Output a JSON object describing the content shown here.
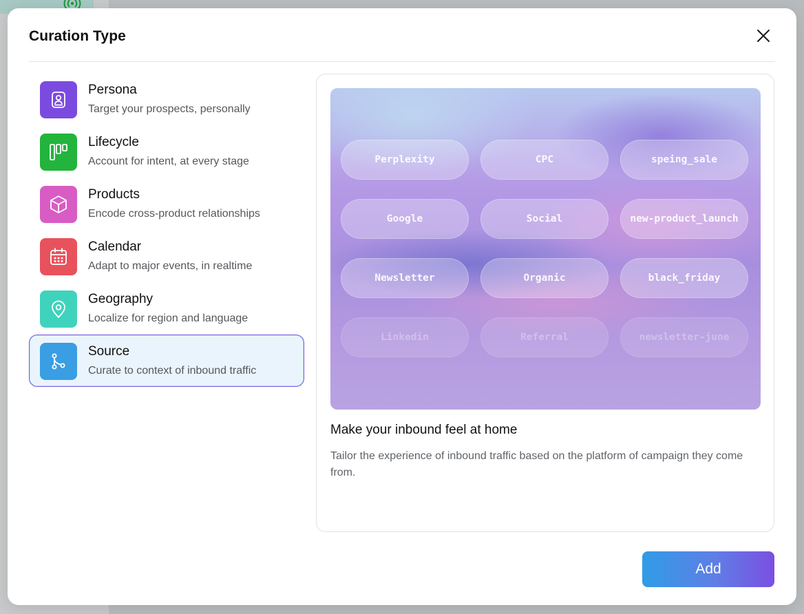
{
  "dialog": {
    "title": "Curation Type",
    "close_icon": "close-icon"
  },
  "curation_types": [
    {
      "name": "Persona",
      "description": "Target your prospects, personally",
      "icon": "persona-icon",
      "color": "#7b4be0",
      "selected": false
    },
    {
      "name": "Lifecycle",
      "description": "Account for intent, at every stage",
      "icon": "lifecycle-icon",
      "color": "#22b43c",
      "selected": false
    },
    {
      "name": "Products",
      "description": "Encode cross-product relationships",
      "icon": "cube-icon",
      "color": "#d95cc4",
      "selected": false
    },
    {
      "name": "Calendar",
      "description": "Adapt to major events, in realtime",
      "icon": "calendar-icon",
      "color": "#e8525c",
      "selected": false
    },
    {
      "name": "Geography",
      "description": "Localize for region and language",
      "icon": "location-pin-icon",
      "color": "#3fd3bd",
      "selected": false
    },
    {
      "name": "Source",
      "description": "Curate to context of inbound traffic",
      "icon": "branch-icon",
      "color": "#3a9ee4",
      "selected": true
    }
  ],
  "preview": {
    "chips": [
      {
        "label": "Perplexity",
        "faded": false
      },
      {
        "label": "CPC",
        "faded": false
      },
      {
        "label": "speing_sale",
        "faded": false
      },
      {
        "label": "Google",
        "faded": false
      },
      {
        "label": "Social",
        "faded": false
      },
      {
        "label": "new-product_launch",
        "faded": false
      },
      {
        "label": "Newsletter",
        "faded": false
      },
      {
        "label": "Organic",
        "faded": false
      },
      {
        "label": "black_friday",
        "faded": false
      },
      {
        "label": "Linkedin",
        "faded": true
      },
      {
        "label": "Referral",
        "faded": true
      },
      {
        "label": "newsletter-june",
        "faded": true
      }
    ],
    "title": "Make your inbound feel at home",
    "description": "Tailor the experience of inbound traffic based on the platform of campaign they come from."
  },
  "footer": {
    "add_label": "Add",
    "add_gradient": [
      "#2f9ce6",
      "#7b4fe2"
    ]
  }
}
